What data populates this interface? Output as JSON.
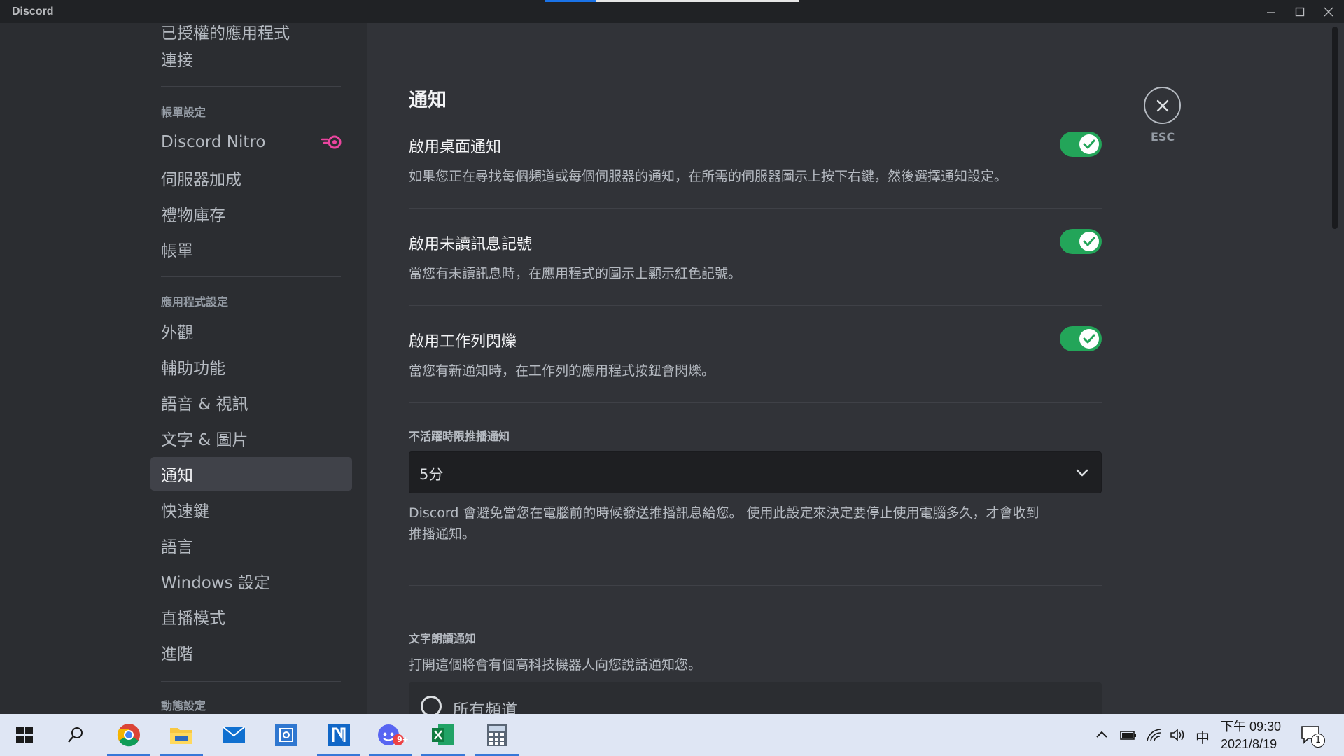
{
  "window": {
    "app_title": "Discord",
    "loading_progress": 0.2
  },
  "sidebar": {
    "top_cut_item": "已授權的應用程式",
    "top_item": "連接",
    "billing_header": "帳單設定",
    "billing_items": [
      "Discord Nitro",
      "伺服器加成",
      "禮物庫存",
      "帳單"
    ],
    "app_header": "應用程式設定",
    "app_items": [
      "外觀",
      "輔助功能",
      "語音 & 視訊",
      "文字 & 圖片",
      "通知",
      "快速鍵",
      "語言",
      "Windows 設定",
      "直播模式",
      "進階"
    ],
    "active_item": "通知",
    "activity_header": "動態設定"
  },
  "main": {
    "title": "通知",
    "close_label": "ESC",
    "settings": [
      {
        "title": "啟用桌面通知",
        "desc": "如果您正在尋找每個頻道或每個伺服器的通知，在所需的伺服器圖示上按下右鍵，然後選擇通知設定。",
        "enabled": true
      },
      {
        "title": "啟用未讀訊息記號",
        "desc": "當您有未讀訊息時，在應用程式的圖示上顯示紅色記號。",
        "enabled": true
      },
      {
        "title": "啟用工作列閃爍",
        "desc": "當您有新通知時，在工作列的應用程式按鈕會閃爍。",
        "enabled": true
      }
    ],
    "afk": {
      "label": "不活躍時限推播通知",
      "value": "5分",
      "desc_line1": "Discord 會避免當您在電腦前的時候發送推播訊息給您。 使用此設定來決定要停止使用電腦多久，才會收到",
      "desc_line2": "推播通知。"
    },
    "tts": {
      "label": "文字朗讀通知",
      "desc": "打開這個將會有個高科技機器人向您說話通知您。",
      "option_first": "所有頻道"
    }
  },
  "taskbar": {
    "apps": [
      "start-icon",
      "search-icon",
      "chrome-icon",
      "file-explorer-icon",
      "mail-icon",
      "app-icon",
      "notion-icon",
      "discord-icon",
      "excel-icon",
      "calculator-icon"
    ],
    "discord_badge": "9+",
    "ime": "中",
    "time": "下午 09:30",
    "date": "2021/8/19",
    "notif_count": "1"
  },
  "colors": {
    "toggle_on": "#23a559",
    "nitro_pink": "#eb459f",
    "background": "#313338",
    "sidebar": "#2b2d31"
  }
}
